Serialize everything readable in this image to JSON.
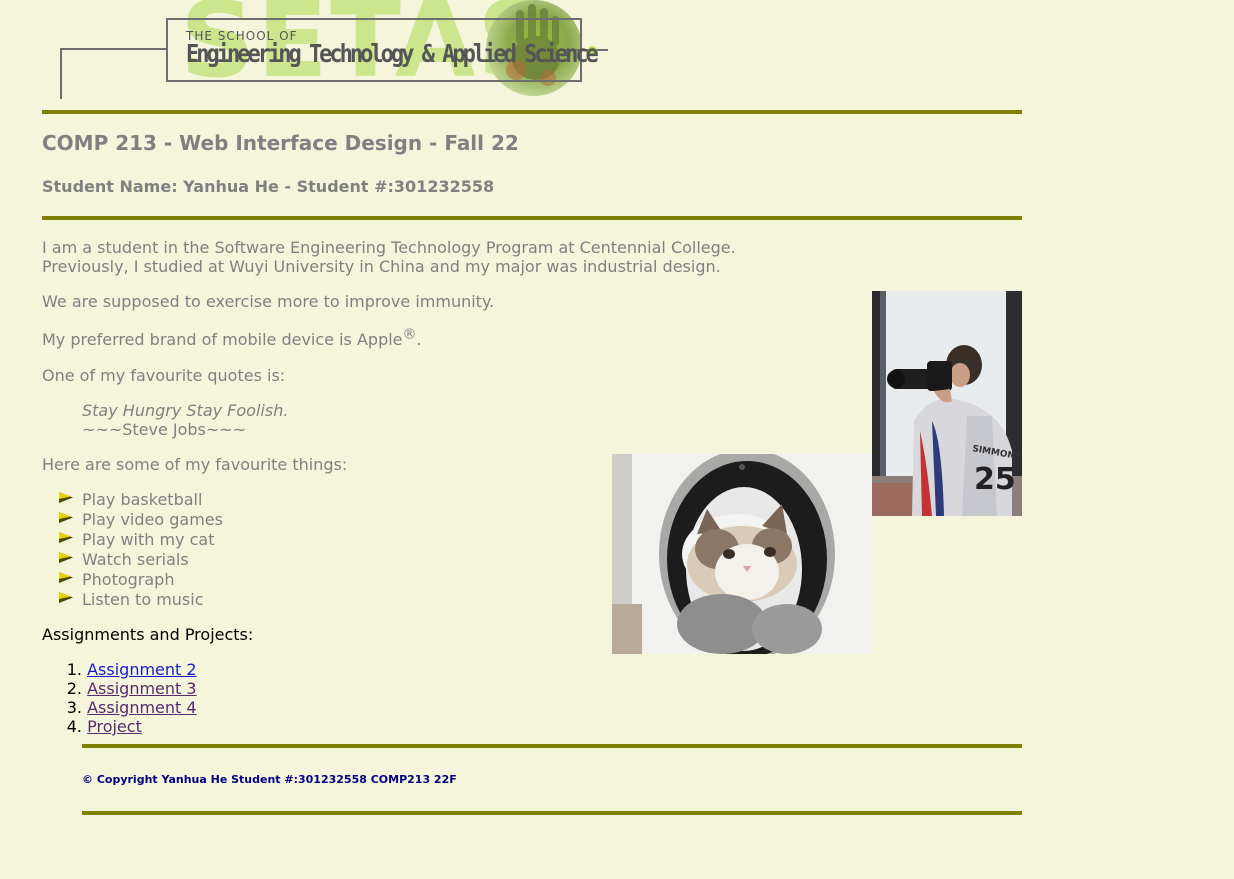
{
  "header": {
    "logo_big": "SETAS",
    "logo_small": "THE SCHOOL OF",
    "logo_main": "Engineering Technology & Applied Science"
  },
  "page": {
    "title": "COMP 213 - Web Interface Design - Fall 22",
    "subtitle": "Student Name: Yanhua He - Student #:301232558"
  },
  "intro": {
    "line1": "I am a student in the Software Engineering Technology Program at Centennial College.",
    "line2": "Previously, I studied at Wuyi University in China and my major was industrial design.",
    "exercise": "We are supposed to exercise more to improve immunity.",
    "brand_prefix": "My preferred brand of mobile device is Apple",
    "brand_mark": "®",
    "brand_suffix": ".",
    "quote_intro": "One of my favourite quotes is:",
    "quote": "Stay Hungry Stay Foolish.",
    "quote_author": "~~~Steve Jobs~~~",
    "things_intro": "Here are some of my favourite things:"
  },
  "things": [
    "Play basketball",
    "Play video games",
    "Play with my cat",
    "Watch serials",
    "Photograph",
    "Listen to music"
  ],
  "assignments": {
    "heading": "Assignments and Projects:",
    "items": [
      {
        "num": "1.",
        "label": "Assignment 2"
      },
      {
        "num": "2.",
        "label": "Assignment 3"
      },
      {
        "num": "3.",
        "label": "Assignment 4"
      },
      {
        "num": "4.",
        "label": "Project"
      }
    ]
  },
  "footer": {
    "copyright": "©  Copyright Yanhua He Student #:301232558 COMP213 22F"
  },
  "colors": {
    "background": "#f5f5dc",
    "rule": "#808000",
    "text": "#808080",
    "footer_text": "#000080"
  },
  "icons": [
    "bullet-arrow-icon"
  ]
}
